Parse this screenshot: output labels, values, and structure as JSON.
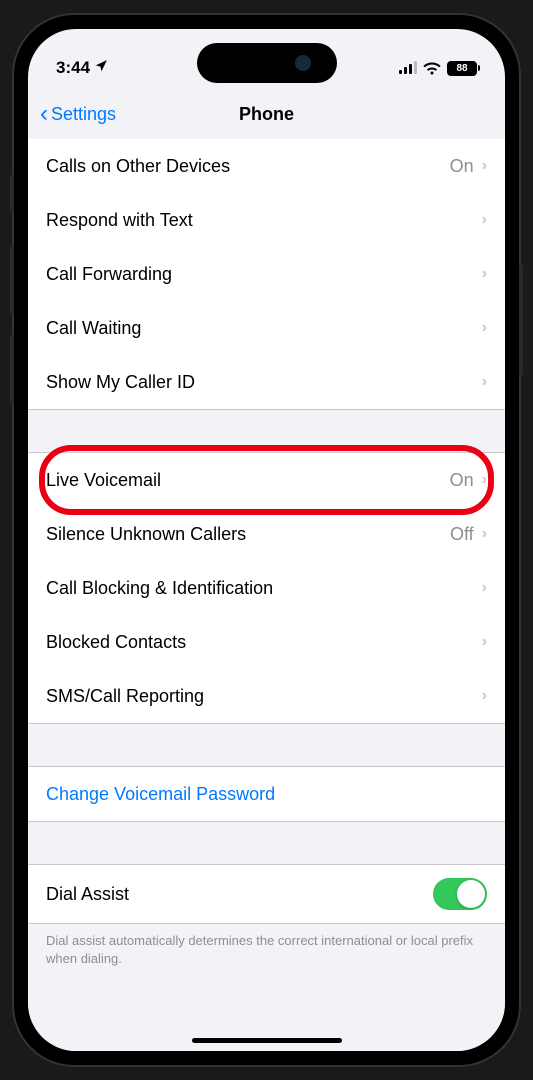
{
  "status": {
    "time": "3:44",
    "battery": "88"
  },
  "nav": {
    "back": "Settings",
    "title": "Phone"
  },
  "group1": {
    "row0": {
      "label": "Calls on Other Devices",
      "value": "On"
    },
    "row1": {
      "label": "Respond with Text"
    },
    "row2": {
      "label": "Call Forwarding"
    },
    "row3": {
      "label": "Call Waiting"
    },
    "row4": {
      "label": "Show My Caller ID"
    }
  },
  "group2": {
    "row0": {
      "label": "Live Voicemail",
      "value": "On"
    },
    "row1": {
      "label": "Silence Unknown Callers",
      "value": "Off"
    },
    "row2": {
      "label": "Call Blocking & Identification"
    },
    "row3": {
      "label": "Blocked Contacts"
    },
    "row4": {
      "label": "SMS/Call Reporting"
    }
  },
  "group3": {
    "row0": {
      "label": "Change Voicemail Password"
    }
  },
  "group4": {
    "row0": {
      "label": "Dial Assist"
    },
    "footer": "Dial assist automatically determines the correct international or local prefix when dialing."
  },
  "highlighted_row": "Live Voicemail"
}
